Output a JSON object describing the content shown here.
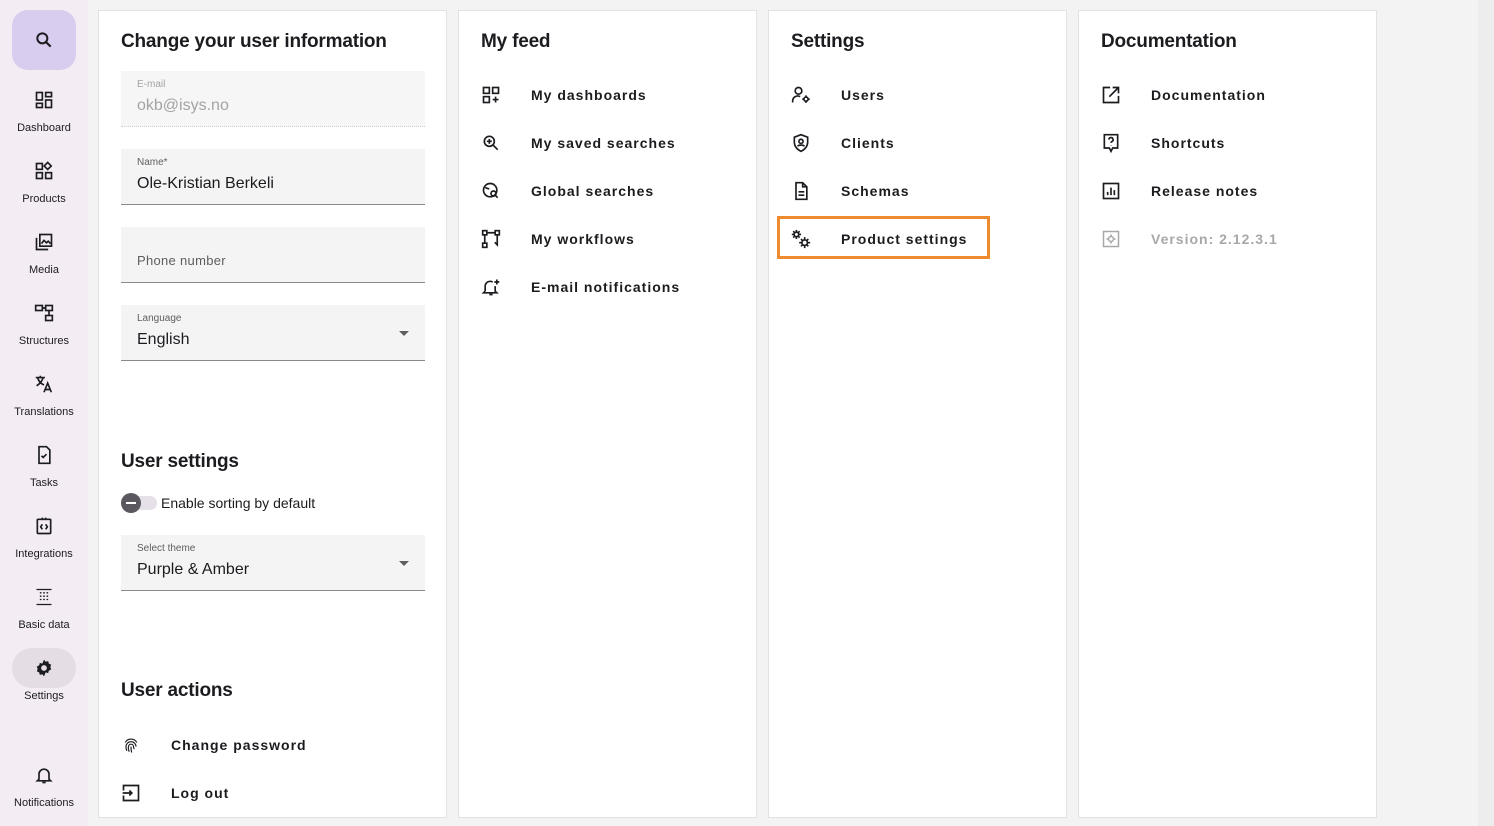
{
  "sidebar": {
    "items": [
      {
        "label": "Dashboard",
        "icon": "dashboard-icon"
      },
      {
        "label": "Products",
        "icon": "products-icon"
      },
      {
        "label": "Media",
        "icon": "media-icon"
      },
      {
        "label": "Structures",
        "icon": "structures-icon"
      },
      {
        "label": "Translations",
        "icon": "translate-icon"
      },
      {
        "label": "Tasks",
        "icon": "task-icon"
      },
      {
        "label": "Integrations",
        "icon": "integrations-icon"
      },
      {
        "label": "Basic data",
        "icon": "basic-data-icon"
      },
      {
        "label": "Settings",
        "icon": "gear-icon",
        "active": true
      },
      {
        "label": "Notifications",
        "icon": "bell-icon"
      }
    ]
  },
  "user_info": {
    "title": "Change your user information",
    "email": {
      "label": "E-mail",
      "value": "okb@isys.no"
    },
    "name": {
      "label": "Name*",
      "value": "Ole-Kristian Berkeli"
    },
    "phone": {
      "placeholder": "Phone number"
    },
    "language": {
      "label": "Language",
      "value": "English"
    },
    "user_settings_title": "User settings",
    "sorting_toggle_label": "Enable sorting by default",
    "theme": {
      "label": "Select theme",
      "value": "Purple & Amber"
    },
    "user_actions_title": "User actions",
    "change_password": "Change password",
    "log_out": "Log out"
  },
  "feed": {
    "title": "My feed",
    "items": [
      "My dashboards",
      "My saved searches",
      "Global searches",
      "My workflows",
      "E-mail notifications"
    ]
  },
  "settings": {
    "title": "Settings",
    "items": [
      "Users",
      "Clients",
      "Schemas",
      "Product settings"
    ],
    "highlight_color": "#f08a2e"
  },
  "documentation": {
    "title": "Documentation",
    "items": [
      "Documentation",
      "Shortcuts",
      "Release notes"
    ],
    "version": "Version: 2.12.3.1"
  },
  "colors": {
    "accent": "#d8ccef",
    "sidebar_bg": "#f3edf3",
    "highlight": "#f08a2e"
  }
}
